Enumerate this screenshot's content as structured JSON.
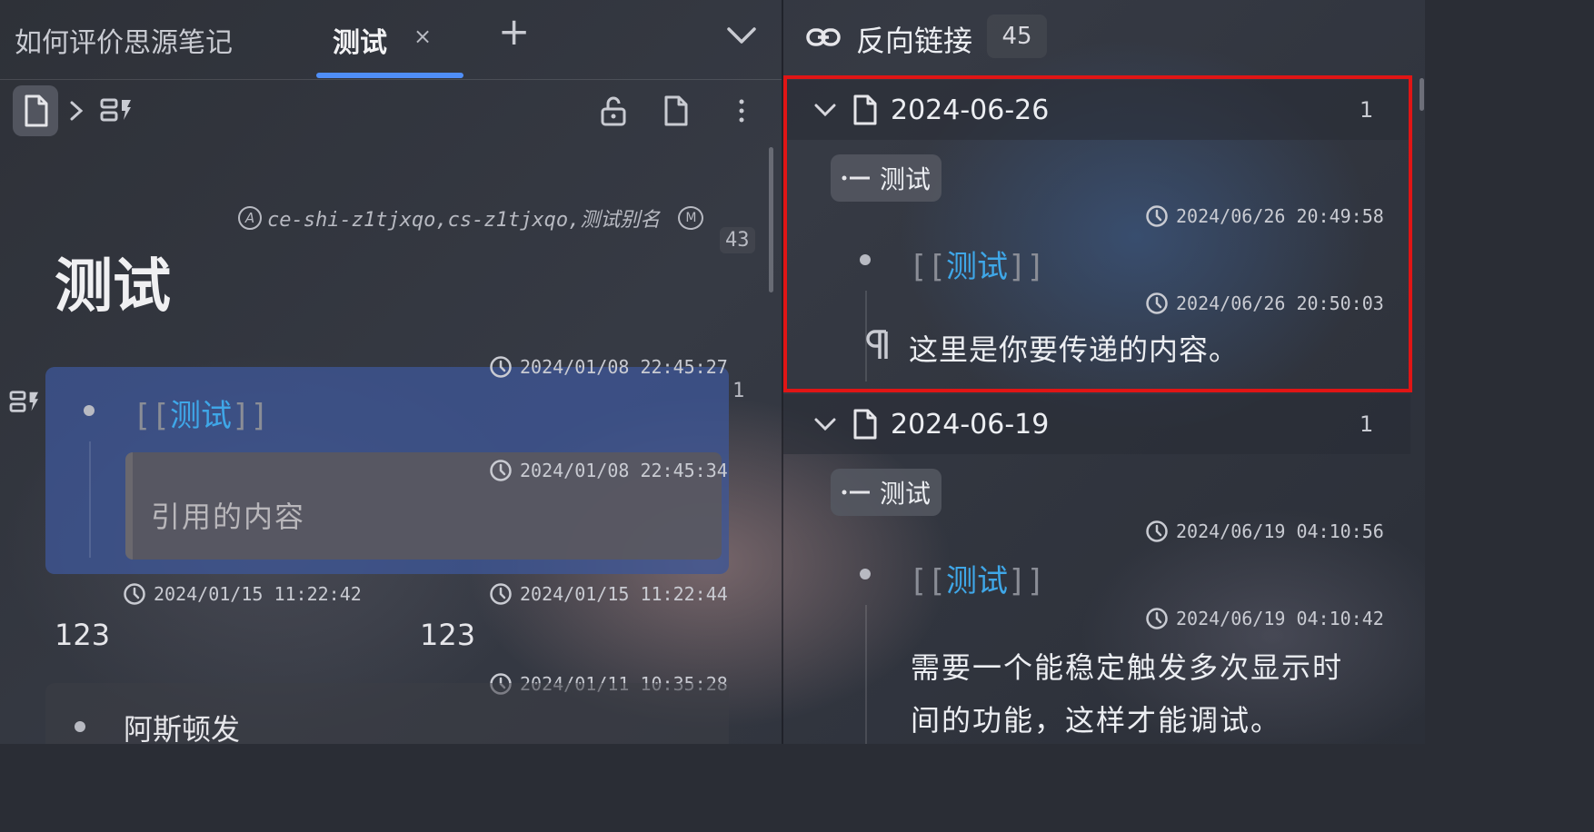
{
  "left": {
    "tab_doc_title": "如何评价思源笔记",
    "tab_active": "测试",
    "tab_close": "×",
    "tab_add": "+",
    "alias_text": "ce-shi-z1tjxqo,cs-z1tjxqo,测试别名",
    "alias_badge": "A",
    "memo_badge": "M",
    "ref_count": "43",
    "doc_title": "测试",
    "block1": {
      "time": "2024/01/08 22:45:27",
      "count": "1",
      "ref_prefix": "[[",
      "ref_link": "测试",
      "ref_suffix": "]]",
      "quote_time": "2024/01/08 22:45:34",
      "quote_text": "引用的内容"
    },
    "row1": {
      "time_a": "2024/01/15 11:22:42",
      "time_b": "2024/01/15 11:22:44",
      "val_a": "123",
      "val_b": "123"
    },
    "block2": {
      "time": "2024/01/11 10:35:28",
      "text": "阿斯顿发"
    }
  },
  "right": {
    "title": "反向链接",
    "count": "45",
    "groups": [
      {
        "date": "2024-06-26",
        "count": "1",
        "crumb": "测试",
        "time1": "2024/06/26 20:49:58",
        "ref_prefix": "[[",
        "ref_link": "测试",
        "ref_suffix": "]]",
        "time2": "2024/06/26 20:50:03",
        "para": "这里是你要传递的内容。"
      },
      {
        "date": "2024-06-19",
        "count": "1",
        "crumb": "测试",
        "time1": "2024/06/19 04:10:56",
        "ref_prefix": "[[",
        "ref_link": "测试",
        "ref_suffix": "]]",
        "time2": "2024/06/19 04:10:42",
        "para_line1": "需要一个能稳定触发多次显示时",
        "para_line2": "间的功能，这样才能调试。"
      }
    ]
  },
  "colors": {
    "accent_blue": "#4f8ef7",
    "link": "#3fa7e8",
    "highlight_block": "#3d5590",
    "red_frame": "#e01515"
  }
}
